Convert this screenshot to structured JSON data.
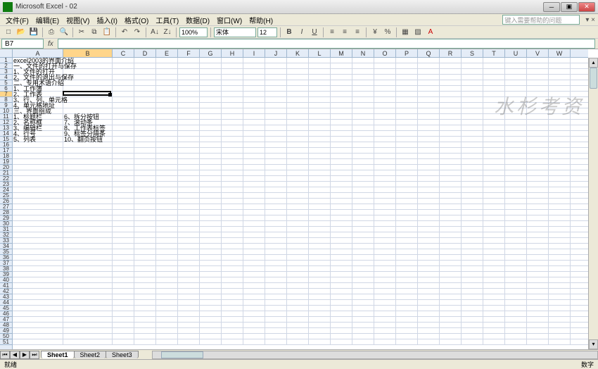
{
  "window": {
    "title": "Microsoft Excel - 02"
  },
  "help_placeholder": "键入需要帮助的问题",
  "menu": [
    "文件(F)",
    "编辑(E)",
    "视图(V)",
    "插入(I)",
    "格式(O)",
    "工具(T)",
    "数据(D)",
    "窗口(W)",
    "帮助(H)"
  ],
  "toolbar": {
    "zoom": "100%",
    "font": "宋体",
    "font_size": "12"
  },
  "namebox": "B7",
  "columns": [
    "A",
    "B",
    "C",
    "D",
    "E",
    "F",
    "G",
    "H",
    "I",
    "J",
    "K",
    "L",
    "M",
    "N",
    "O",
    "P",
    "Q",
    "R",
    "S",
    "T",
    "U",
    "V",
    "W"
  ],
  "col_widths": {
    "A": 72,
    "B": 70,
    "default": 31
  },
  "row_count": 51,
  "active": {
    "row": 7,
    "col": "B"
  },
  "cells": {
    "A1": "excel2003的界面介绍",
    "A2": "一、文件的打开与保存",
    "A3": "1、文件的打开",
    "A4": "2、文件的退出与保存",
    "A5": "二、专用术语介绍",
    "A6": "1、工作簿",
    "A7": "2、工作表",
    "A8": "3、行、列、单元格",
    "A9": "4、单元格地址",
    "A10": "三、界面组成",
    "A11": "1、标题栏",
    "B11": "6、拆分按钮",
    "A12": "2、名称框",
    "B12": "7、滚动条",
    "A13": "3、编辑栏",
    "B13": "8、工作表标签",
    "A14": "4、行号",
    "B14": "9、标签分隔条",
    "A15": "5、列表",
    "B15": "10、翻页按钮"
  },
  "sheets": {
    "active": 0,
    "tabs": [
      "Sheet1",
      "Sheet2",
      "Sheet3"
    ]
  },
  "status": {
    "left": "就绪",
    "right": "数字"
  },
  "watermark": "水杉考资"
}
